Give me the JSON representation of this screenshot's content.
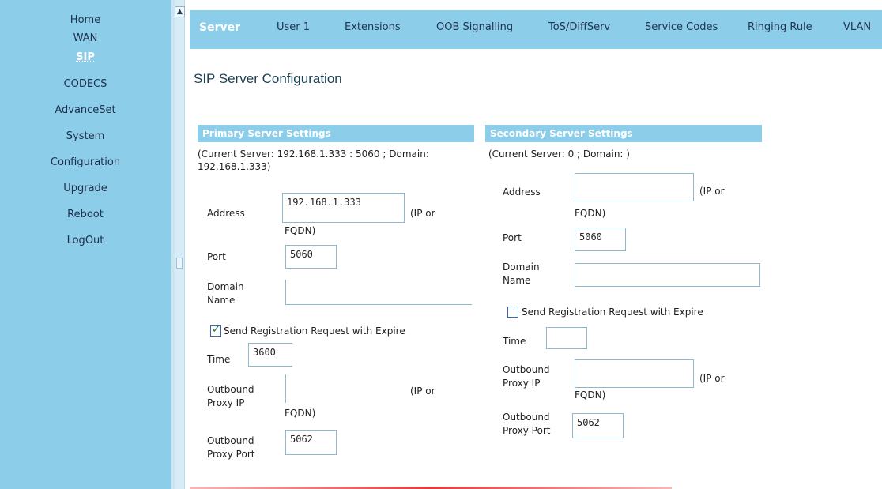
{
  "sidebar": {
    "items": [
      {
        "label": "Home"
      },
      {
        "label": "WAN"
      },
      {
        "label": "SIP"
      },
      {
        "label": "CODECS"
      },
      {
        "label": "AdvanceSet"
      },
      {
        "label": "System"
      },
      {
        "label": "Configuration"
      },
      {
        "label": "Upgrade"
      },
      {
        "label": "Reboot"
      },
      {
        "label": "LogOut"
      }
    ],
    "active_item": "SIP"
  },
  "tabs": [
    {
      "label": "Server"
    },
    {
      "label": "User 1"
    },
    {
      "label": "Extensions"
    },
    {
      "label": "OOB Signalling"
    },
    {
      "label": "ToS/DiffServ"
    },
    {
      "label": "Service Codes"
    },
    {
      "label": "Ringing Rule"
    },
    {
      "label": "VLAN"
    }
  ],
  "page_title": "SIP Server Configuration",
  "primary": {
    "header": "Primary Server Settings",
    "current_line1": "(Current Server: 192.168.1.333 : 5060 ; Domain:",
    "current_line2": "192.168.1.333)",
    "address_label": "Address",
    "address_value": "192.168.1.333",
    "address_hint": "(IP or",
    "address_hint2": "FQDN)",
    "port_label": "Port",
    "port_value": "5060",
    "domain_label1": "Domain",
    "domain_label2": "Name",
    "domain_value": "",
    "register_label": "Send Registration Request with Expire",
    "register_checked": true,
    "time_label": "Time",
    "time_value": "3600",
    "proxy_ip_label1": "Outbound",
    "proxy_ip_label2": "Proxy IP",
    "proxy_ip_value": "",
    "proxy_ip_hint": "(IP or",
    "proxy_ip_hint2": "FQDN)",
    "proxy_port_label1": "Outbound",
    "proxy_port_label2": "Proxy Port",
    "proxy_port_value": "5062"
  },
  "secondary": {
    "header": "Secondary Server Settings",
    "current_line1": "(Current Server: 0 ; Domain: )",
    "address_label": "Address",
    "address_value": "",
    "address_hint": "(IP or",
    "address_hint2": "FQDN)",
    "port_label": "Port",
    "port_value": "5060",
    "domain_label1": "Domain",
    "domain_label2": "Name",
    "domain_value": "",
    "register_label": "Send Registration Request with Expire",
    "register_checked": false,
    "time_label": "Time",
    "time_value": "",
    "proxy_ip_label1": "Outbound",
    "proxy_ip_label2": "Proxy IP",
    "proxy_ip_value": "",
    "proxy_ip_hint": "(IP or",
    "proxy_ip_hint2": "FQDN)",
    "proxy_port_label1": "Outbound",
    "proxy_port_label2": "Proxy Port",
    "proxy_port_value": "5062"
  },
  "colors": {
    "nav_bg": "#8ccde9",
    "header_bg": "#8ccde9",
    "field_border": "#8fb8cf",
    "bottom_rule": "#e23b3b"
  }
}
